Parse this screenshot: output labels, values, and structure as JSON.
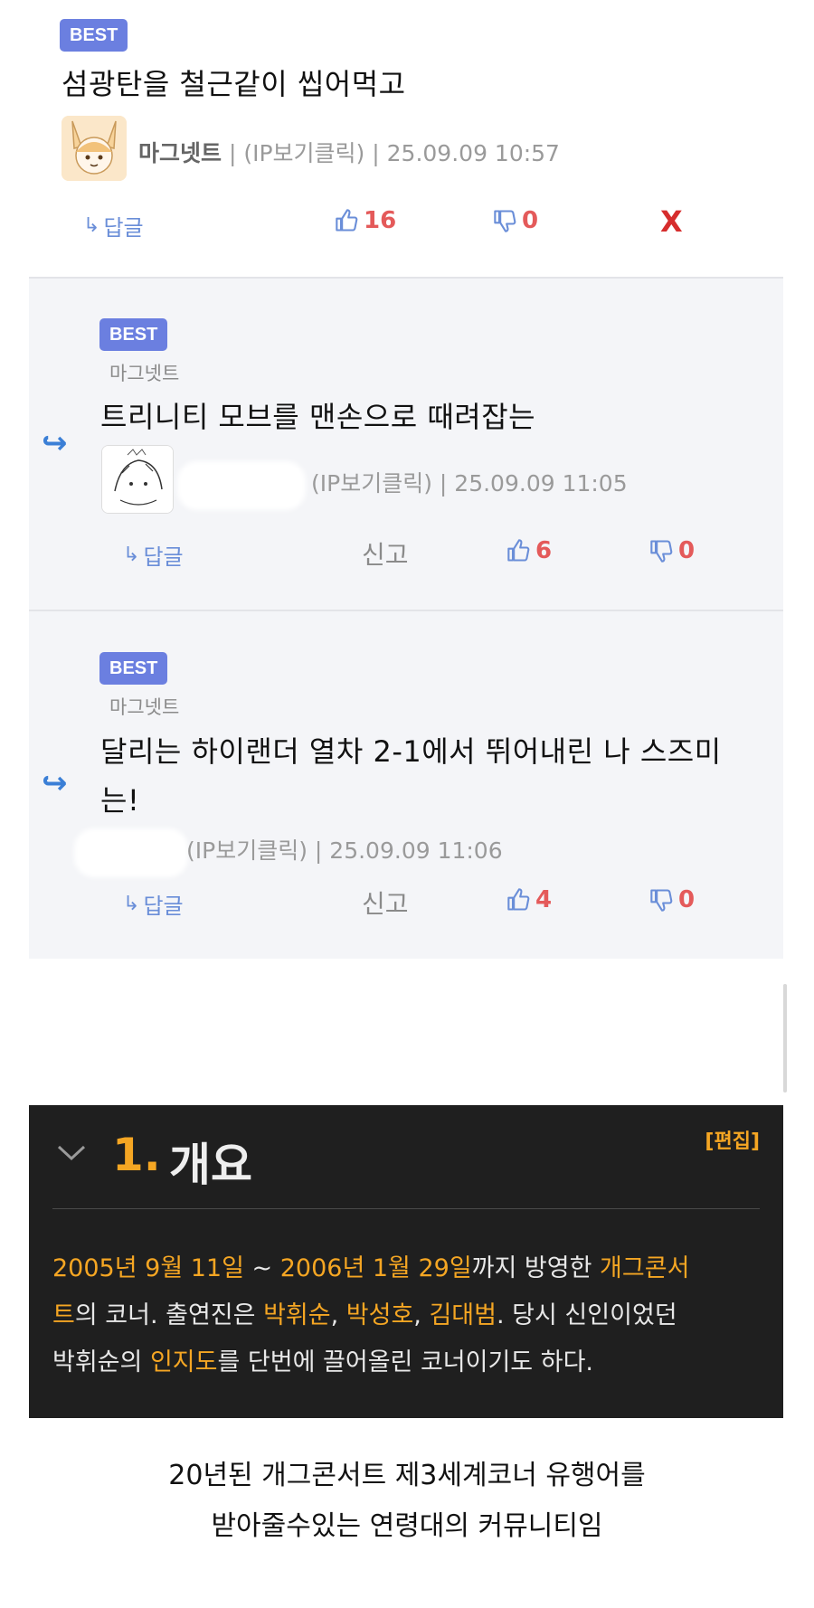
{
  "comments": [
    {
      "badge": "BEST",
      "text": "섬광탄을 철근같이 씹어먹고",
      "nickname": "마그넷트",
      "ip_label": "(IP보기클릭)",
      "datetime": "25.09.09 10:57",
      "reply_label": "답글",
      "likes": "16",
      "dislikes": "0",
      "delete_label": "X"
    }
  ],
  "replies": [
    {
      "badge": "BEST",
      "parent_nick": "마그넷트",
      "text": "트리니티 모브를 맨손으로 때려잡는",
      "ip_label": "(IP보기클릭)",
      "datetime": "25.09.09 11:05",
      "reply_label": "답글",
      "report_label": "신고",
      "likes": "6",
      "dislikes": "0"
    },
    {
      "badge": "BEST",
      "parent_nick": "마그넷트",
      "text_line1": "달리는 하이랜더 열차 2-1에서 뛰어내린 나 스즈미",
      "text_line2": "는!",
      "ip_label": "(IP보기클릭)",
      "datetime": "25.09.09 11:06",
      "reply_label": "답글",
      "report_label": "신고",
      "likes": "4",
      "dislikes": "0"
    }
  ],
  "wiki": {
    "number": "1.",
    "heading": "개요",
    "edit_label": "[편집]",
    "body": {
      "date_start": "2005년 9월 11일",
      "tilde": " ~ ",
      "date_end": "2006년 1월 29일",
      "t1": "까지 방영한 ",
      "show_a": "개그콘서",
      "show_b": "트",
      "t2": "의 코너. 출연진은 ",
      "cast1": "박휘순",
      "sep1": ", ",
      "cast2": "박성호",
      "sep2": ", ",
      "cast3": "김대범",
      "t3": ". 당시 신인이었던",
      "t4": "박휘순의 ",
      "fame": "인지도",
      "t5": "를 단번에 끌어올린 코너이기도 하다."
    }
  },
  "caption": {
    "line1": "20년된 개그콘서트 제3세계코너 유행어를",
    "line2": "받아줄수있는 연령대의 커뮤니티임"
  },
  "colors": {
    "best_badge": "#6b7fe0",
    "like": "#e45a5a",
    "reply_action": "#6a8ed8",
    "wiki_bg": "#1f1f1f",
    "wiki_highlight": "#f5a623",
    "delete": "#d62d2d"
  }
}
